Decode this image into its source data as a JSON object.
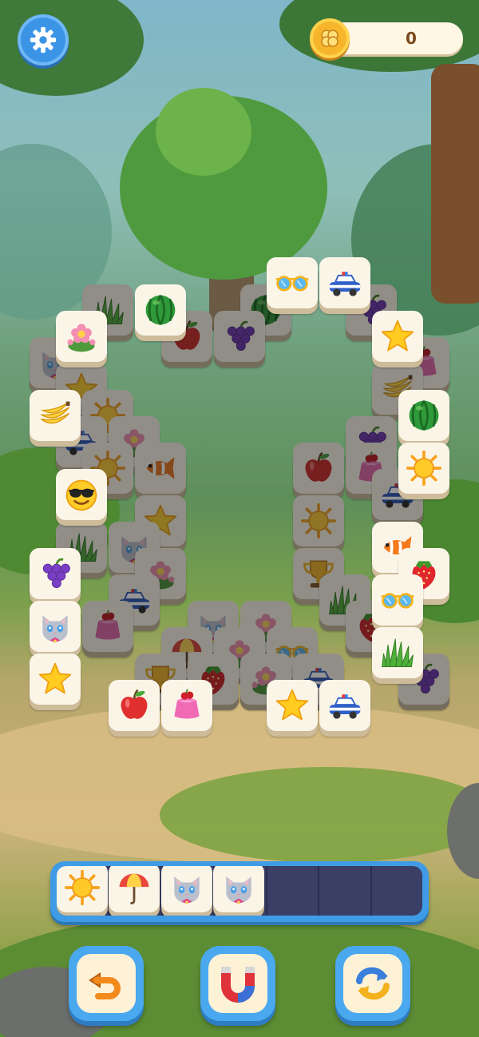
{
  "hud": {
    "coins": "0",
    "settings_icon": "gear-icon",
    "coin_icon": "clover-coin-icon"
  },
  "board": {
    "tiles": [
      {
        "id": "t01",
        "icon": "grass",
        "dim": true
      },
      {
        "id": "t02",
        "icon": "watermelon",
        "dim": false
      },
      {
        "id": "t03",
        "icon": "sunglasses",
        "dim": false
      },
      {
        "id": "t04",
        "icon": "police-car",
        "dim": false
      },
      {
        "id": "t05",
        "icon": "watermelon",
        "dim": true
      },
      {
        "id": "t06",
        "icon": "grapes",
        "dim": true
      },
      {
        "id": "t07",
        "icon": "flowers",
        "dim": false
      },
      {
        "id": "t08",
        "icon": "apple",
        "dim": true
      },
      {
        "id": "t09",
        "icon": "grapes",
        "dim": true
      },
      {
        "id": "t10",
        "icon": "star",
        "dim": false
      },
      {
        "id": "t11",
        "icon": "cat",
        "dim": true
      },
      {
        "id": "t12",
        "icon": "jelly",
        "dim": true
      },
      {
        "id": "t13",
        "icon": "star",
        "dim": true
      },
      {
        "id": "t14",
        "icon": "banana",
        "dim": false
      },
      {
        "id": "t15",
        "icon": "sun",
        "dim": true
      },
      {
        "id": "t16",
        "icon": "banana",
        "dim": true
      },
      {
        "id": "t17",
        "icon": "watermelon",
        "dim": false
      },
      {
        "id": "t18",
        "icon": "police-car",
        "dim": true
      },
      {
        "id": "t19",
        "icon": "flowers",
        "dim": true
      },
      {
        "id": "t20",
        "icon": "grapes",
        "dim": true
      },
      {
        "id": "t21",
        "icon": "sun",
        "dim": false
      },
      {
        "id": "t22",
        "icon": "sun",
        "dim": true
      },
      {
        "id": "t23",
        "icon": "fish",
        "dim": true
      },
      {
        "id": "t24",
        "icon": "apple",
        "dim": true
      },
      {
        "id": "t25",
        "icon": "jelly",
        "dim": true
      },
      {
        "id": "t26",
        "icon": "smiley-sunglasses",
        "dim": false
      },
      {
        "id": "t27",
        "icon": "star",
        "dim": true
      },
      {
        "id": "t28",
        "icon": "police-car",
        "dim": true
      },
      {
        "id": "t29",
        "icon": "grass",
        "dim": true
      },
      {
        "id": "t30",
        "icon": "cat",
        "dim": true
      },
      {
        "id": "t31",
        "icon": "sun",
        "dim": true
      },
      {
        "id": "t32",
        "icon": "fish",
        "dim": false
      },
      {
        "id": "t33",
        "icon": "grapes",
        "dim": false
      },
      {
        "id": "t34",
        "icon": "flowers",
        "dim": true
      },
      {
        "id": "t35",
        "icon": "trophy",
        "dim": true
      },
      {
        "id": "t36",
        "icon": "strawberry",
        "dim": false
      },
      {
        "id": "t37",
        "icon": "cat",
        "dim": false
      },
      {
        "id": "t38",
        "icon": "jelly",
        "dim": true
      },
      {
        "id": "t39",
        "icon": "police-car",
        "dim": true
      },
      {
        "id": "t40",
        "icon": "grass",
        "dim": true
      },
      {
        "id": "t41",
        "icon": "sunglasses",
        "dim": false
      },
      {
        "id": "t42",
        "icon": "star",
        "dim": false
      },
      {
        "id": "t43",
        "icon": "cat",
        "dim": true
      },
      {
        "id": "t44",
        "icon": "flowers",
        "dim": true
      },
      {
        "id": "t45",
        "icon": "strawberry",
        "dim": true
      },
      {
        "id": "t46",
        "icon": "grass",
        "dim": false
      },
      {
        "id": "t47",
        "icon": "umbrella",
        "dim": true
      },
      {
        "id": "t48",
        "icon": "flowers",
        "dim": true
      },
      {
        "id": "t49",
        "icon": "sunglasses",
        "dim": true
      },
      {
        "id": "t50",
        "icon": "grapes",
        "dim": true
      },
      {
        "id": "t51",
        "icon": "trophy",
        "dim": true
      },
      {
        "id": "t52",
        "icon": "strawberry",
        "dim": true
      },
      {
        "id": "t53",
        "icon": "flowers",
        "dim": true
      },
      {
        "id": "t54",
        "icon": "police-car",
        "dim": true
      },
      {
        "id": "t55",
        "icon": "apple",
        "dim": false
      },
      {
        "id": "t56",
        "icon": "jelly",
        "dim": false
      },
      {
        "id": "t57",
        "icon": "star",
        "dim": false
      },
      {
        "id": "t58",
        "icon": "police-car",
        "dim": false
      }
    ]
  },
  "tray": {
    "capacity": 7,
    "items": [
      "sun",
      "umbrella",
      "cat",
      "cat"
    ]
  },
  "tools": [
    {
      "name": "undo-button",
      "icon": "undo-arrow-icon"
    },
    {
      "name": "magnet-button",
      "icon": "magnet-icon"
    },
    {
      "name": "shuffle-button",
      "icon": "shuffle-icon"
    }
  ]
}
